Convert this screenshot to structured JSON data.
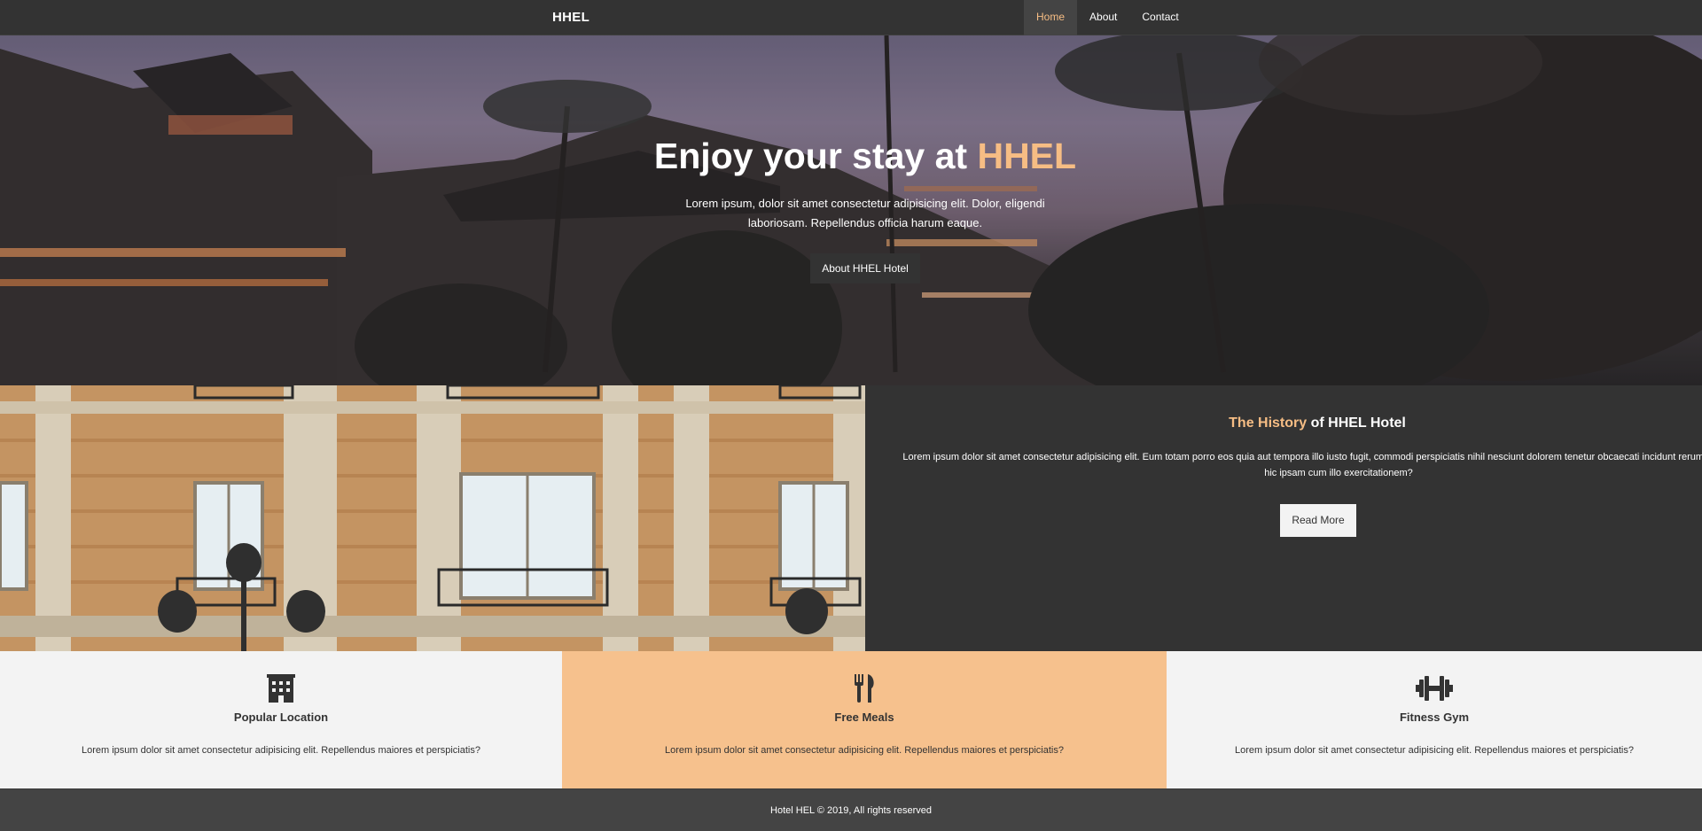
{
  "nav": {
    "brand": "HHEL",
    "links": [
      {
        "label": "Home",
        "active": true
      },
      {
        "label": "About",
        "active": false
      },
      {
        "label": "Contact",
        "active": false
      }
    ]
  },
  "hero": {
    "title_prefix": "Enjoy your stay at ",
    "title_accent": "HHEL",
    "subtitle": "Lorem ipsum, dolor sit amet consectetur adipisicing elit. Dolor, eligendi laboriosam. Repellendus officia harum eaque.",
    "button_label": "About HHEL Hotel"
  },
  "history": {
    "title_accent": "The History",
    "title_rest": " of HHEL Hotel",
    "text": "Lorem ipsum dolor sit amet consectetur adipisicing elit. Eum totam porro eos quia aut tempora illo iusto fugit, commodi perspiciatis nihil nesciunt dolorem tenetur obcaecati incidunt rerum distinctio autem hic ipsam cum illo exercitationem?",
    "button_label": "Read More"
  },
  "features": [
    {
      "icon": "building-icon",
      "title": "Popular Location",
      "text": "Lorem ipsum dolor sit amet consectetur adipisicing elit. Repellendus maiores et perspiciatis?"
    },
    {
      "icon": "utensils-icon",
      "title": "Free Meals",
      "text": "Lorem ipsum dolor sit amet consectetur adipisicing elit. Repellendus maiores et perspiciatis?"
    },
    {
      "icon": "dumbbell-icon",
      "title": "Fitness Gym",
      "text": "Lorem ipsum dolor sit amet consectetur adipisicing elit. Repellendus maiores et perspiciatis?"
    }
  ],
  "footer": {
    "text": "Hotel HEL © 2019, All rights reserved"
  },
  "colors": {
    "accent": "#f6bd84",
    "dark": "#333333",
    "light": "#f3f3f3",
    "feature_highlight": "#f6c18d"
  }
}
